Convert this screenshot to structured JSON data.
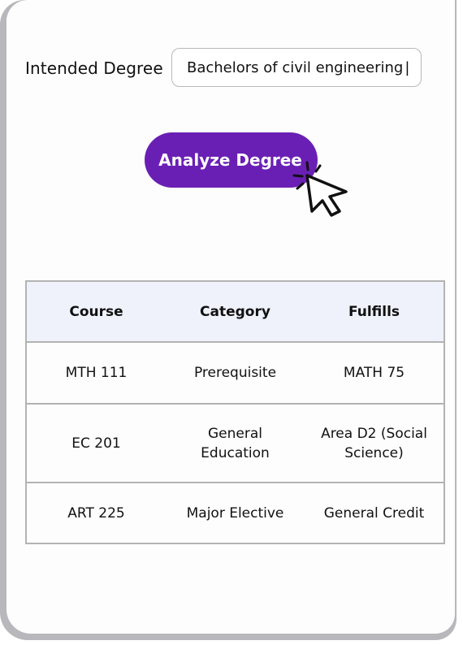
{
  "form": {
    "degree_label": "Intended Degree",
    "degree_value": "Bachelors of civil engineering",
    "caret": "|",
    "analyze_label": "Analyze Degree"
  },
  "table": {
    "headers": [
      "Course",
      "Category",
      "Fulfills"
    ],
    "rows": [
      [
        "MTH 111",
        "Prerequisite",
        "MATH 75"
      ],
      [
        "EC 201",
        "General Education",
        "Area D2 (Social Science)"
      ],
      [
        "ART 225",
        "Major Elective",
        "General Credit"
      ]
    ]
  },
  "colors": {
    "accent": "#6a1fb4",
    "header_bg": "#eff2fb",
    "border": "#b3b3b3"
  },
  "icons": {
    "pointer": "cursor-click-icon"
  }
}
